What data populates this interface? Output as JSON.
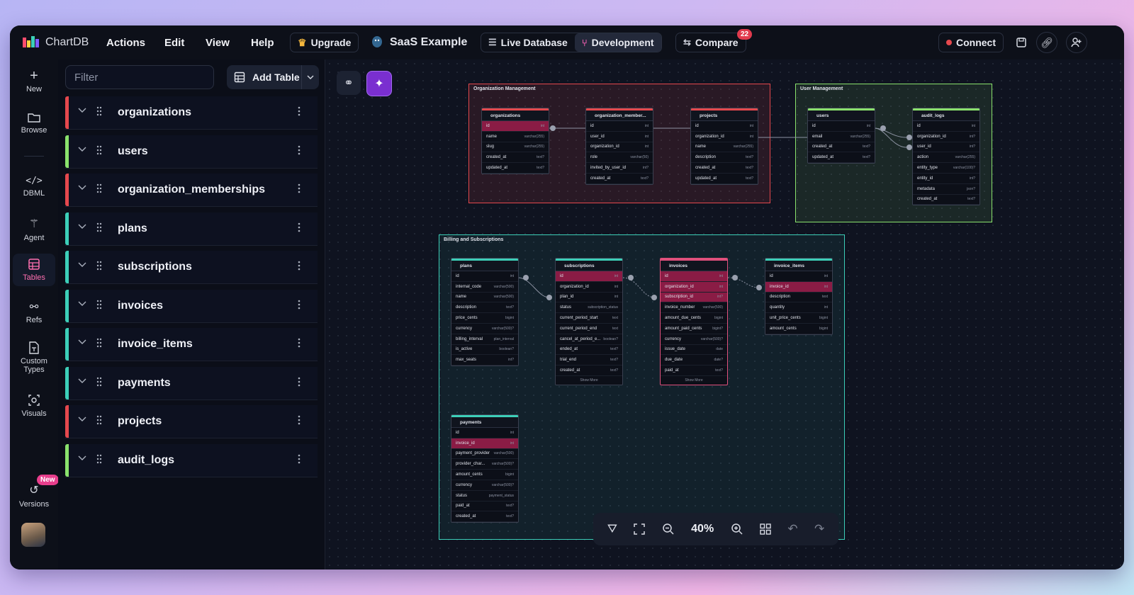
{
  "app": {
    "name": "ChartDB",
    "menus": [
      "Actions",
      "Edit",
      "View",
      "Help"
    ],
    "upgrade": "Upgrade",
    "diagram_name": "SaaS Example"
  },
  "header": {
    "live_database": "Live Database",
    "development": "Development",
    "compare": "Compare",
    "compare_badge": "22",
    "connect": "Connect"
  },
  "rail": {
    "new": "New",
    "browse": "Browse",
    "dbml": "DBML",
    "agent": "Agent",
    "tables": "Tables",
    "refs": "Refs",
    "custom_types_1": "Custom",
    "custom_types_2": "Types",
    "visuals": "Visuals",
    "versions": "Versions",
    "versions_badge": "New"
  },
  "sidebar": {
    "filter_placeholder": "Filter",
    "add_table": "Add Table",
    "tables": [
      {
        "name": "organizations",
        "color": "#e5484d"
      },
      {
        "name": "users",
        "color": "#8ae26c"
      },
      {
        "name": "organization_memberships",
        "color": "#e5484d"
      },
      {
        "name": "plans",
        "color": "#3ccfb8"
      },
      {
        "name": "subscriptions",
        "color": "#3ccfb8"
      },
      {
        "name": "invoices",
        "color": "#3ccfb8"
      },
      {
        "name": "invoice_items",
        "color": "#3ccfb8"
      },
      {
        "name": "payments",
        "color": "#3ccfb8"
      },
      {
        "name": "projects",
        "color": "#e5484d"
      },
      {
        "name": "audit_logs",
        "color": "#8ae26c"
      }
    ]
  },
  "areas": {
    "org": "Organization Management",
    "user": "User Management",
    "billing": "Billing and Subscriptions"
  },
  "diagram": {
    "organizations": {
      "title": "organizations",
      "rows": [
        [
          "id",
          "int"
        ],
        [
          "name",
          "varchar(255)"
        ],
        [
          "slug",
          "varchar(255)"
        ],
        [
          "created_at",
          "text?"
        ],
        [
          "updated_at",
          "text?"
        ]
      ]
    },
    "org_members": {
      "title": "organization_member...",
      "rows": [
        [
          "id",
          "int"
        ],
        [
          "user_id",
          "int"
        ],
        [
          "organization_id",
          "int"
        ],
        [
          "role",
          "varchar(50)"
        ],
        [
          "invited_by_user_id",
          "int?"
        ],
        [
          "created_at",
          "text?"
        ]
      ]
    },
    "projects": {
      "title": "projects",
      "rows": [
        [
          "id",
          "int"
        ],
        [
          "organization_id",
          "int"
        ],
        [
          "name",
          "varchar(255)"
        ],
        [
          "description",
          "text?"
        ],
        [
          "created_at",
          "text?"
        ],
        [
          "updated_at",
          "text?"
        ]
      ]
    },
    "users": {
      "title": "users",
      "rows": [
        [
          "id",
          "int"
        ],
        [
          "email",
          "varchar(255)"
        ],
        [
          "created_at",
          "text?"
        ],
        [
          "updated_at",
          "text?"
        ]
      ]
    },
    "audit_logs": {
      "title": "audit_logs",
      "rows": [
        [
          "id",
          "int"
        ],
        [
          "organization_id",
          "int?"
        ],
        [
          "user_id",
          "int?"
        ],
        [
          "action",
          "varchar(255)"
        ],
        [
          "entity_type",
          "varchar(100)?"
        ],
        [
          "entity_id",
          "int?"
        ],
        [
          "metadata",
          "json?"
        ],
        [
          "created_at",
          "text?"
        ]
      ]
    },
    "plans": {
      "title": "plans",
      "rows": [
        [
          "id",
          "int"
        ],
        [
          "internal_code",
          "varchar(500)"
        ],
        [
          "name",
          "varchar(500)"
        ],
        [
          "description",
          "text?"
        ],
        [
          "price_cents",
          "bigint"
        ],
        [
          "currency",
          "varchar(500)?"
        ],
        [
          "billing_interval",
          "plan_interval"
        ],
        [
          "is_active",
          "boolean?"
        ],
        [
          "max_seats",
          "int?"
        ]
      ]
    },
    "subscriptions": {
      "title": "subscriptions",
      "rows": [
        [
          "id",
          "int"
        ],
        [
          "organization_id",
          "int"
        ],
        [
          "plan_id",
          "int"
        ],
        [
          "status",
          "subscription_status"
        ],
        [
          "current_period_start",
          "text"
        ],
        [
          "current_period_end",
          "text"
        ],
        [
          "cancel_at_period_e...",
          "boolean?"
        ],
        [
          "ended_at",
          "text?"
        ],
        [
          "trial_end",
          "text?"
        ],
        [
          "created_at",
          "text?"
        ]
      ],
      "show_more": "Show More"
    },
    "invoices": {
      "title": "invoices",
      "rows": [
        [
          "id",
          "int"
        ],
        [
          "organization_id",
          "int"
        ],
        [
          "subscription_id",
          "int?"
        ],
        [
          "invoice_number",
          "varchar(500)"
        ],
        [
          "amount_due_cents",
          "bigint"
        ],
        [
          "amount_paid_cents",
          "bigint?"
        ],
        [
          "currency",
          "varchar(500)?"
        ],
        [
          "issue_date",
          "date"
        ],
        [
          "due_date",
          "date?"
        ],
        [
          "paid_at",
          "text?"
        ]
      ],
      "show_more": "Show More"
    },
    "invoice_items": {
      "title": "invoice_items",
      "rows": [
        [
          "id",
          "int"
        ],
        [
          "invoice_id",
          "int"
        ],
        [
          "description",
          "text"
        ],
        [
          "quantity",
          "int"
        ],
        [
          "unit_price_cents",
          "bigint"
        ],
        [
          "amount_cents",
          "bigint"
        ]
      ]
    },
    "payments": {
      "title": "payments",
      "rows": [
        [
          "id",
          "int"
        ],
        [
          "invoice_id",
          "int"
        ],
        [
          "payment_provider",
          "varchar(500)"
        ],
        [
          "provider_char...",
          "varchar(500)?"
        ],
        [
          "amount_cents",
          "bigint"
        ],
        [
          "currency",
          "varchar(500)?"
        ],
        [
          "status",
          "payment_status"
        ],
        [
          "paid_at",
          "text?"
        ],
        [
          "created_at",
          "text?"
        ]
      ]
    }
  },
  "zoom": "40%"
}
